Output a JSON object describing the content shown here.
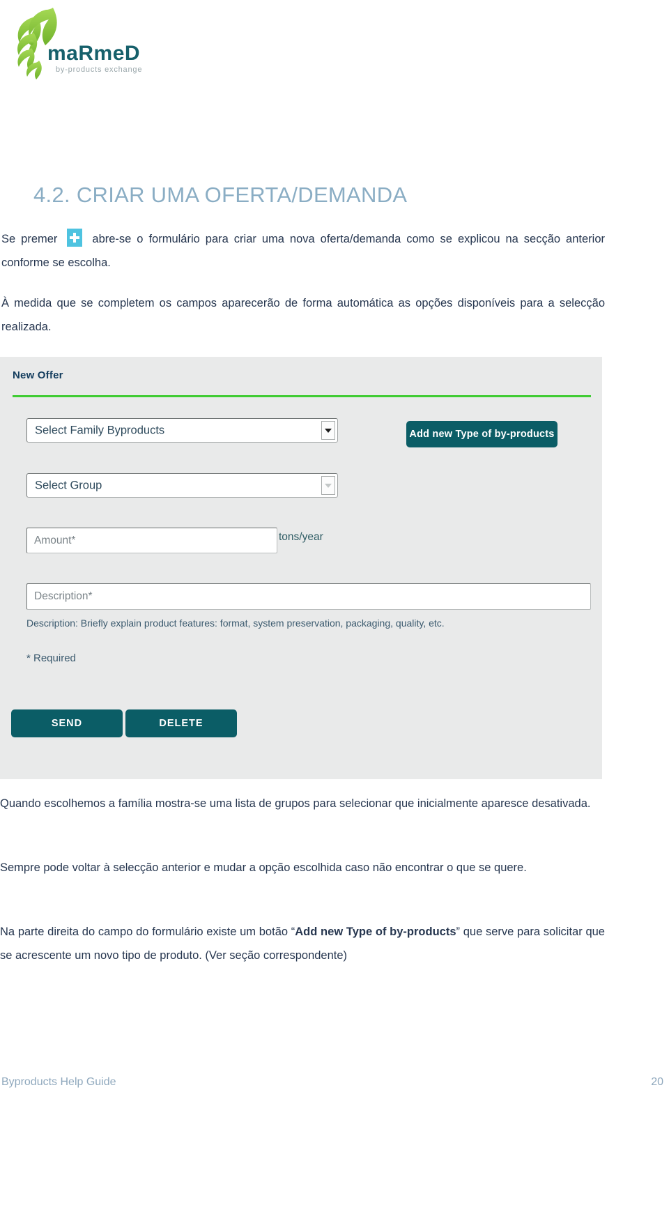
{
  "logo": {
    "wordmark": "marmeD",
    "tagline": "by-products exchange",
    "leaf_color": "#8cc63f",
    "wordmark_color": "#16606b"
  },
  "heading": "4.2. CRIAR UMA OFERTA/DEMANDA",
  "paragraphs": {
    "intro_before_icon": "Se      premer",
    "intro_after_icon": "abre-se o formulário para criar uma nova oferta/demanda como se explicou na secção anterior conforme se escolha.",
    "auto": "À medida que se completem os campos   aparecerão de forma automática as opções disponíveis para a selecção realizada.",
    "closing_1": "Quando escolhemos a família mostra-se uma lista de grupos para selecionar que inicialmente aparesce desativada.",
    "closing_2": "Sempre pode voltar à selecção anterior e mudar a opção escolhida caso não encontrar o que se quere.",
    "closing_3_part1": "Na parte direita do campo do formulário existe um botão “",
    "closing_3_bold": "Add new Type of by-products",
    "closing_3_part2": "”  que serve para solicitar que se acrescente um novo tipo de produto. (Ver seção correspondente)"
  },
  "figure": {
    "title": "New Offer",
    "accent_rule_color": "#3fcc33",
    "background": "#e9eaea",
    "select_family": {
      "label": "Select Family Byproducts",
      "enabled": true
    },
    "select_group": {
      "label": "Select Group",
      "enabled": false
    },
    "add_type_button": "Add new Type of by-products",
    "amount_placeholder": "Amount*",
    "amount_unit": "tons/year",
    "description_placeholder": "Description*",
    "description_helper": "Description: Briefly explain product features: format, system preservation, packaging, quality, etc.",
    "required_note": "* Required",
    "send_button": "SEND",
    "delete_button": "DELETE",
    "button_color": "#0b5d66"
  },
  "footer": {
    "left": "Byproducts Help Guide",
    "page_number": "20"
  }
}
